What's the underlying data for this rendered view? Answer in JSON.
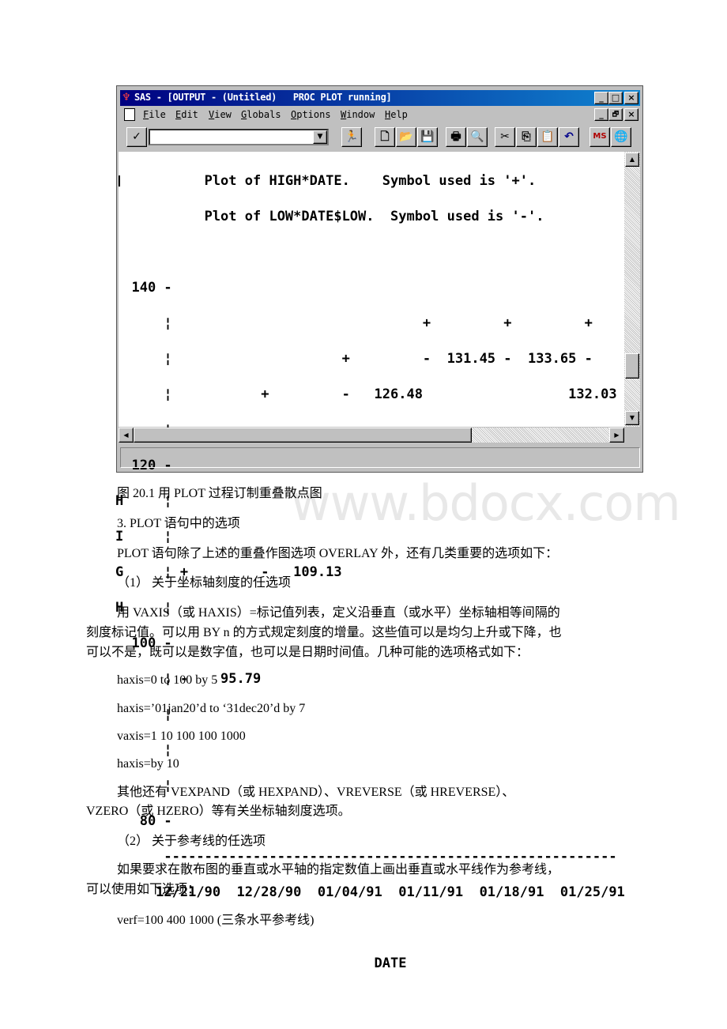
{
  "window": {
    "title": "SAS - [OUTPUT - (Untitled)   PROC PLOT running]",
    "title_buttons": [
      "_",
      "□",
      "×"
    ],
    "menu": [
      {
        "key": "F",
        "rest": "ile"
      },
      {
        "key": "E",
        "rest": "dit"
      },
      {
        "key": "V",
        "rest": "iew"
      },
      {
        "key": "G",
        "rest": "lobals"
      },
      {
        "key": "O",
        "rest": "ptions"
      },
      {
        "key": "W",
        "rest": "indow"
      },
      {
        "key": "H",
        "rest": "elp"
      }
    ],
    "doc_buttons": [
      "_",
      "🗗",
      "×"
    ],
    "toolbar": {
      "check": "✓",
      "command_value": "",
      "dropdown": "▼",
      "icons": [
        "run-icon",
        "new-icon",
        "open-icon",
        "save-icon",
        "print-icon",
        "preview-icon",
        "cut-icon",
        "copy-icon",
        "paste-icon",
        "undo-icon",
        "msdos-icon",
        "globe-icon"
      ],
      "glyphs": [
        "🏃",
        "🗋",
        "📂",
        "💾",
        "🖶",
        "🔍",
        "✂",
        "⎘",
        "📋",
        "↶",
        "MS",
        "🌐"
      ]
    },
    "scroll": {
      "up": "▲",
      "down": "▼",
      "left": "◀",
      "right": "▶"
    },
    "status": ""
  },
  "plot": {
    "lines": [
      "           Plot of HIGH*DATE.    Symbol used is '+'.",
      "           Plot of LOW*DATE$LOW.  Symbol used is '-'.",
      "",
      "  140 -",
      "      ¦                               +         +         +",
      "      ¦                     +         -  131.45 -  133.65 -",
      "      ¦           +         -   126.48                  132.03",
      "      ¦",
      "  120 -",
      "H     ¦",
      "I     ¦",
      "G     ¦ +         -   109.13",
      "H     ¦",
      "  100 -",
      "      ¦ -    95.79",
      "      ¦",
      "      ¦",
      "      ¦",
      "   80 -",
      "      --------------------------------------------------------",
      "     12/21/90  12/28/90  01/04/91  01/11/91  01/18/91  01/25/91",
      "",
      "                                DATE"
    ]
  },
  "document": {
    "watermark": "www.bdocx.com",
    "caption": "图 20.1 用 PLOT 过程订制重叠散点图",
    "section": "3. PLOT 语句中的选项",
    "intro": "PLOT 语句除了上述的重叠作图选项 OVERLAY 外，还有几类重要的选项如下：",
    "sub1": "（1） 关于坐标轴刻度的任选项",
    "para1": [
      "用 VAXIS（或 HAXIS）=标记值列表，定义沿垂直（或水平）坐标轴相等间隔的",
      "刻度标记值。可以用 BY n 的方式规定刻度的增量。这些值可以是均匀上升或下降，也",
      "可以不是，既可以是数字值，也可以是日期时间值。几种可能的选项格式如下："
    ],
    "code1": [
      "haxis=0 to 100 by 5",
      "haxis=’01jan20’d to ‘31dec20’d by 7",
      "vaxis=1 10 100 100 1000",
      "haxis=by 10"
    ],
    "para2": [
      "其他还有 VEXPAND（或 HEXPAND）、VREVERSE（或 HREVERSE）、",
      "VZERO（或 HZERO）等有关坐标轴刻度选项。"
    ],
    "sub2": "（2） 关于参考线的任选项",
    "para3": [
      "如果要求在散布图的垂直或水平轴的指定数值上画出垂直或水平线作为参考线，",
      "可以使用如下选项："
    ],
    "code2": "verf=100 400 1000 (三条水平参考线)"
  }
}
